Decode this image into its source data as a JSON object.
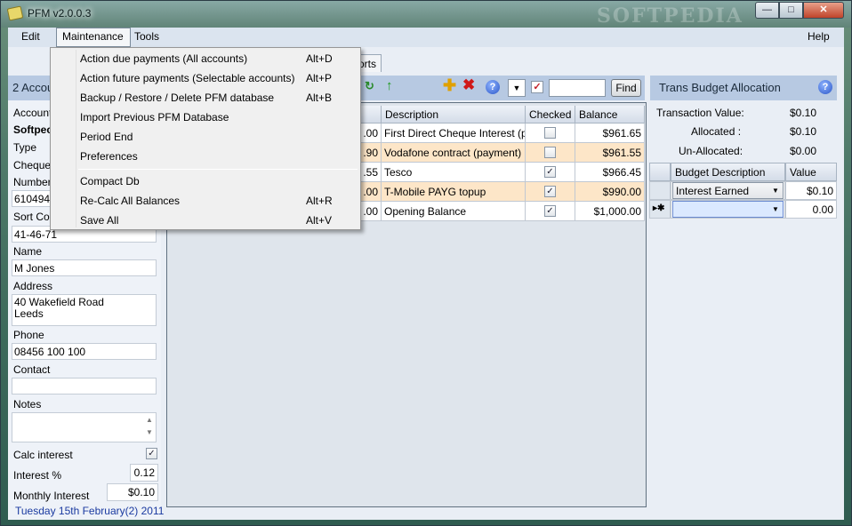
{
  "window": {
    "title": "PFM v2.0.0.3",
    "watermark": "SOFTPEDIA"
  },
  "menubar": {
    "items": [
      "Edit",
      "Maintenance",
      "Tools"
    ],
    "help": "Help"
  },
  "maintenance_menu": {
    "items": [
      {
        "label": "Action due payments (All accounts)",
        "shortcut": "Alt+D"
      },
      {
        "label": "Action future payments (Selectable accounts)",
        "shortcut": "Alt+P"
      },
      {
        "label": "Backup / Restore / Delete PFM database",
        "shortcut": "Alt+B"
      },
      {
        "label": "Import Previous PFM Database",
        "shortcut": ""
      },
      {
        "label": "Period End",
        "shortcut": ""
      },
      {
        "label": "Preferences",
        "shortcut": ""
      },
      {
        "label": "Compact Db",
        "shortcut": ""
      },
      {
        "label": "Re-Calc All Balances",
        "shortcut": "Alt+R"
      },
      {
        "label": "Save All",
        "shortcut": "Alt+V"
      }
    ]
  },
  "tabs": {
    "reports_fragment": "orts"
  },
  "account_panel": {
    "header": "2 Accou",
    "account_label": "Account",
    "account_value": "Softpec",
    "type_label": "Type",
    "type_value": "Cheque",
    "number_label": "Number",
    "number_value": "610494",
    "sort_code_label": "Sort Coc",
    "sort_code_value": "41-46-71",
    "name_label": "Name",
    "name_value": "M Jones",
    "address_label": "Address",
    "address_line1": "40 Wakefield Road",
    "address_line2": "Leeds",
    "phone_label": "Phone",
    "phone_value": "08456 100 100",
    "contact_label": "Contact",
    "contact_value": "",
    "notes_label": "Notes",
    "calc_interest_label": "Calc interest",
    "calc_interest_checked": "✓",
    "interest_label": "Interest %",
    "interest_value": "0.12",
    "monthly_interest_label": "Monthly Interest",
    "monthly_interest_value": "$0.10",
    "date": "Tuesday 15th February(2) 2011"
  },
  "toolbar": {
    "find_label": "Find"
  },
  "transactions": {
    "columns": [
      "Description",
      "Checked",
      "Balance"
    ],
    "rows": [
      {
        "amount_fragment": ".00",
        "description": "First Direct Cheque Interest (pa...",
        "checked": false,
        "balance": "$961.65",
        "highlight": false
      },
      {
        "amount_fragment": ".90",
        "description": "Vodafone contract (payment)",
        "checked": false,
        "balance": "$961.55",
        "highlight": true
      },
      {
        "amount_fragment": ".55",
        "description": "Tesco",
        "checked": true,
        "balance": "$966.45",
        "highlight": false
      },
      {
        "amount_fragment": ".00",
        "description": "T-Mobile PAYG topup",
        "checked": true,
        "balance": "$990.00",
        "highlight": true
      },
      {
        "amount_fragment": ".00",
        "description": "Opening Balance",
        "checked": true,
        "balance": "$1,000.00",
        "highlight": false
      }
    ]
  },
  "budget_panel": {
    "header": "Trans Budget Allocation",
    "transaction_value_label": "Transaction Value:",
    "transaction_value": "$0.10",
    "allocated_label": "Allocated :",
    "allocated_value": "$0.10",
    "unallocated_label": "Un-Allocated:",
    "unallocated_value": "$0.00",
    "columns": [
      "Budget Description",
      "Value"
    ],
    "rows": [
      {
        "marker": "",
        "description": "Interest Earned",
        "value": "$0.10"
      },
      {
        "marker": "▸✱",
        "description": "",
        "value": "0.00"
      }
    ]
  },
  "colors": {
    "highlight_row": "#fde6c8",
    "panel_header": "#b7c9e2",
    "date_text": "#1a3aa0"
  }
}
